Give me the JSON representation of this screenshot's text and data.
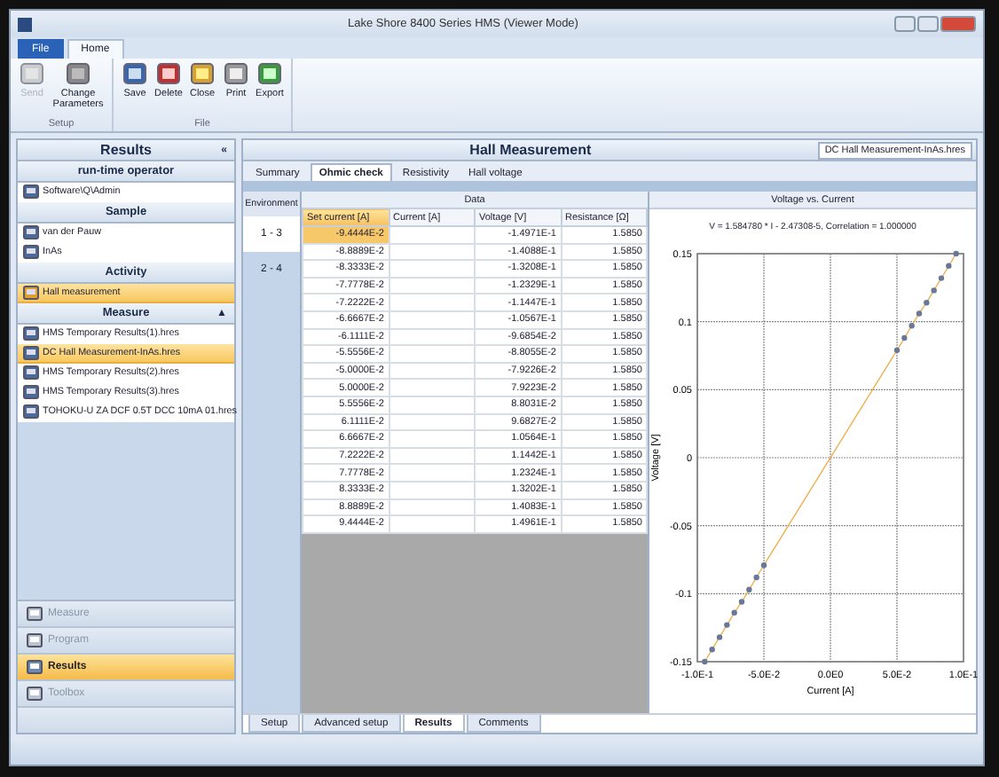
{
  "window": {
    "title": "Lake Shore 8400 Series HMS (Viewer Mode)"
  },
  "ribbon_tabs": [
    {
      "label": "File",
      "selected": false
    },
    {
      "label": "Home",
      "selected": true
    }
  ],
  "ribbon_groups": [
    {
      "label": "Setup",
      "buttons": [
        {
          "label": "Send",
          "disabled": true
        },
        {
          "label": "Change Parameters",
          "disabled": false
        }
      ]
    },
    {
      "label": "File",
      "buttons": [
        {
          "label": "Save",
          "disabled": false
        },
        {
          "label": "Delete",
          "disabled": false
        },
        {
          "label": "Close",
          "disabled": false
        },
        {
          "label": "Print",
          "disabled": false
        },
        {
          "label": "Export",
          "disabled": false
        }
      ]
    }
  ],
  "sidebar": {
    "title": "Results",
    "collapse": "«",
    "sections": [
      {
        "title": "run-time operator",
        "items": [
          {
            "label": "Software\\Q\\Admin",
            "selected": false
          }
        ]
      },
      {
        "title": "Sample",
        "items": [
          {
            "label": "van der Pauw",
            "selected": false
          },
          {
            "label": "InAs",
            "selected": false
          }
        ]
      },
      {
        "title": "Activity",
        "items": [
          {
            "label": "Hall measurement",
            "selected": true
          }
        ]
      },
      {
        "title": "Measure",
        "toggle": "▲",
        "items": [
          {
            "label": "HMS Temporary Results(1).hres",
            "selected": false
          },
          {
            "label": "DC Hall Measurement-InAs.hres",
            "selected": true
          },
          {
            "label": "HMS Temporary Results(2).hres",
            "selected": false
          },
          {
            "label": "HMS Temporary Results(3).hres",
            "selected": false
          },
          {
            "label": "TOHOKU-U ZA DCF 0.5T DCC 10mA 01.hres",
            "selected": false
          }
        ]
      }
    ],
    "nav": [
      {
        "label": "Measure",
        "selected": false,
        "disabled": true
      },
      {
        "label": "Program",
        "selected": false,
        "disabled": true
      },
      {
        "label": "Results",
        "selected": true,
        "disabled": false
      },
      {
        "label": "Toolbox",
        "selected": false,
        "disabled": true
      }
    ]
  },
  "main": {
    "title": "Hall Measurement",
    "file": "DC Hall Measurement-InAs.hres",
    "tabs": [
      {
        "label": "Summary",
        "selected": false
      },
      {
        "label": "Ohmic check",
        "selected": true
      },
      {
        "label": "Resistivity",
        "selected": false
      },
      {
        "label": "Hall voltage",
        "selected": false
      }
    ],
    "environment": {
      "title": "Environment",
      "items": [
        {
          "label": "1 - 3",
          "selected": true
        },
        {
          "label": "2 - 4",
          "selected": false
        }
      ]
    },
    "table": {
      "title": "Data",
      "columns": [
        "Set current [A]",
        "Current [A]",
        "Voltage [V]",
        "Resistance [Ω]"
      ],
      "rows": [
        [
          "-9.4444E-2",
          "",
          "-1.4971E-1",
          "1.5850"
        ],
        [
          "-8.8889E-2",
          "",
          "-1.4088E-1",
          "1.5850"
        ],
        [
          "-8.3333E-2",
          "",
          "-1.3208E-1",
          "1.5850"
        ],
        [
          "-7.7778E-2",
          "",
          "-1.2329E-1",
          "1.5850"
        ],
        [
          "-7.2222E-2",
          "",
          "-1.1447E-1",
          "1.5850"
        ],
        [
          "-6.6667E-2",
          "",
          "-1.0567E-1",
          "1.5850"
        ],
        [
          "-6.1111E-2",
          "",
          "-9.6854E-2",
          "1.5850"
        ],
        [
          "-5.5556E-2",
          "",
          "-8.8055E-2",
          "1.5850"
        ],
        [
          "-5.0000E-2",
          "",
          "-7.9226E-2",
          "1.5850"
        ],
        [
          "5.0000E-2",
          "",
          "7.9223E-2",
          "1.5850"
        ],
        [
          "5.5556E-2",
          "",
          "8.8031E-2",
          "1.5850"
        ],
        [
          "6.1111E-2",
          "",
          "9.6827E-2",
          "1.5850"
        ],
        [
          "6.6667E-2",
          "",
          "1.0564E-1",
          "1.5850"
        ],
        [
          "7.2222E-2",
          "",
          "1.1442E-1",
          "1.5850"
        ],
        [
          "7.7778E-2",
          "",
          "1.2324E-1",
          "1.5850"
        ],
        [
          "8.3333E-2",
          "",
          "1.3202E-1",
          "1.5850"
        ],
        [
          "8.8889E-2",
          "",
          "1.4083E-1",
          "1.5850"
        ],
        [
          "9.4444E-2",
          "",
          "1.4961E-1",
          "1.5850"
        ]
      ]
    },
    "chart_panel": {
      "title": "Voltage vs. Current",
      "equation": "V = 1.584780 * I - 2.47308-5, Correlation = 1.000000",
      "chart_data": {
        "type": "scatter",
        "xlabel": "Current [A]",
        "ylabel": "Voltage [V]",
        "x": [
          -0.094444,
          -0.088889,
          -0.083333,
          -0.077778,
          -0.072222,
          -0.066667,
          -0.061111,
          -0.055556,
          -0.05,
          0.05,
          0.055556,
          0.061111,
          0.066667,
          0.072222,
          0.077778,
          0.083333,
          0.088889,
          0.094444
        ],
        "series": [
          {
            "type": "scatter",
            "color": "#6a7898",
            "values": [
              -0.15,
              -0.141,
              -0.132,
              -0.123,
              -0.114,
              -0.106,
              -0.097,
              -0.088,
              -0.079,
              0.079,
              0.088,
              0.097,
              0.106,
              0.114,
              0.123,
              0.132,
              0.141,
              0.15
            ]
          },
          {
            "type": "line",
            "color": "#f0b050",
            "values": [
              -0.15,
              -0.141,
              -0.132,
              -0.123,
              -0.114,
              -0.106,
              -0.097,
              -0.088,
              -0.079,
              0.079,
              0.088,
              0.097,
              0.106,
              0.114,
              0.123,
              0.132,
              0.141,
              0.15
            ]
          }
        ],
        "grid": true,
        "xlim": [
          -0.1,
          0.1
        ],
        "ylim": [
          -0.15,
          0.15
        ],
        "xticks": [
          {
            "value": -0.1,
            "label": "-1.0E-1"
          },
          {
            "value": -0.05,
            "label": "-5.0E-2"
          },
          {
            "value": 0,
            "label": "0.0E0"
          },
          {
            "value": 0.05,
            "label": "5.0E-2"
          },
          {
            "value": 0.1,
            "label": "1.0E-1"
          }
        ],
        "yticks": [
          {
            "value": 0.15,
            "label": "0.15"
          },
          {
            "value": 0.1,
            "label": "0.1"
          },
          {
            "value": 0.05,
            "label": "0.05"
          },
          {
            "value": 0,
            "label": "0"
          },
          {
            "value": -0.05,
            "label": "-0.05"
          },
          {
            "value": -0.1,
            "label": "-0.1"
          },
          {
            "value": -0.15,
            "label": "-0.15"
          }
        ]
      }
    },
    "bottom_tabs": [
      {
        "label": "Setup",
        "selected": false
      },
      {
        "label": "Advanced setup",
        "selected": false
      },
      {
        "label": "Results",
        "selected": true
      },
      {
        "label": "Comments",
        "selected": false
      }
    ]
  }
}
